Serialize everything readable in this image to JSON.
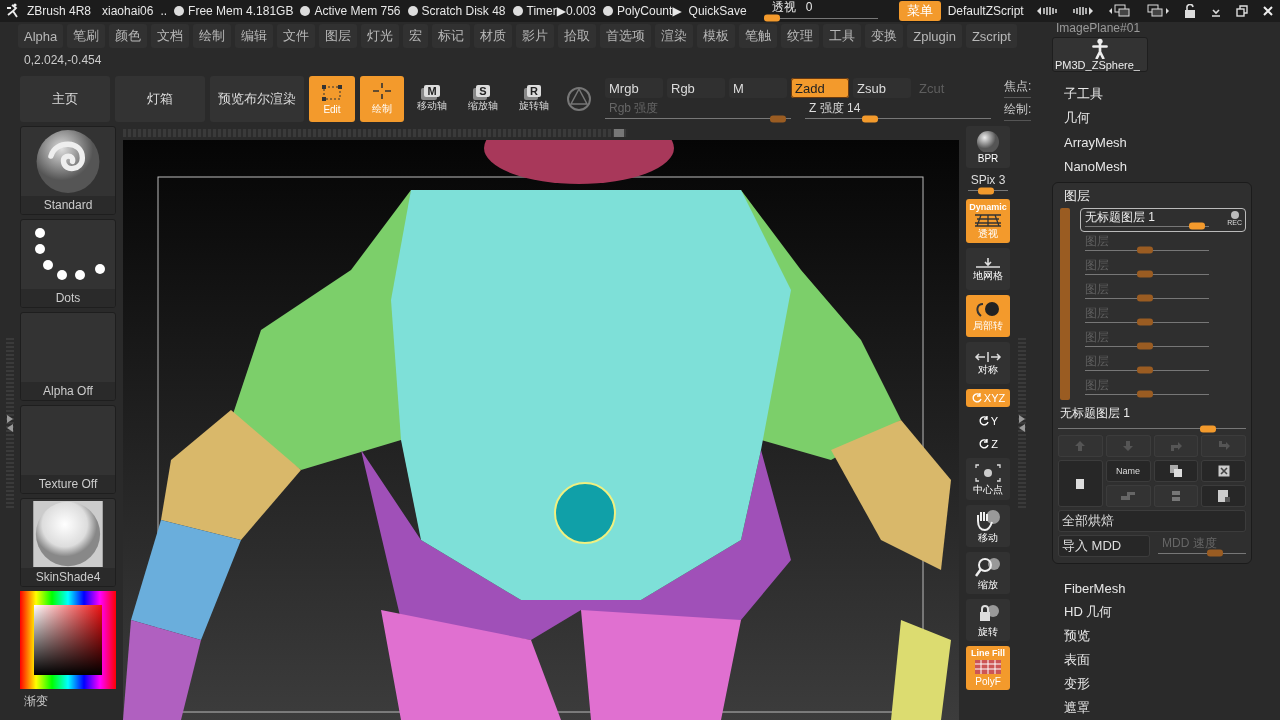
{
  "title_bar": {
    "app": "ZBrush 4R8",
    "user": "xiaohai06",
    "ellipsis": "..",
    "stats": [
      "Free Mem 4.181GB",
      "Active Mem 756",
      "Scratch Disk 48",
      "Timer▶0.003",
      "PolyCount▶"
    ],
    "quick_save": "QuickSave",
    "perspective": {
      "label": "透视",
      "value": "0",
      "level": 0.06
    },
    "menu_button": "菜单",
    "script": "DefaultZScript"
  },
  "menu": [
    "Alpha",
    "笔刷",
    "颜色",
    "文档",
    "绘制",
    "编辑",
    "文件",
    "图层",
    "灯光",
    "宏",
    "标记",
    "材质",
    "影片",
    "拾取",
    "首选项",
    "渲染",
    "模板",
    "笔触",
    "纹理",
    "工具",
    "变换",
    "Zplugin",
    "Zscript"
  ],
  "coordinates": "0,2.024,-0.454",
  "toolbar": [
    {
      "kind": "text",
      "label": "主页"
    },
    {
      "kind": "text",
      "label": "灯箱"
    },
    {
      "kind": "text",
      "label": "预览布尔渲染"
    },
    {
      "kind": "edit",
      "label": "Edit",
      "selected": true
    },
    {
      "kind": "draw",
      "label": "绘制",
      "selected": true
    },
    {
      "kind": "axis",
      "key": "M",
      "label": "移动轴",
      "selected": false
    },
    {
      "kind": "axis",
      "key": "S",
      "label": "缩放轴",
      "selected": false
    },
    {
      "kind": "axis",
      "key": "R",
      "label": "旋转轴",
      "selected": false
    },
    {
      "kind": "sphere"
    }
  ],
  "modes": [
    {
      "label": "Mrgb",
      "selected": false,
      "disabled": false
    },
    {
      "label": "Rgb",
      "selected": false,
      "disabled": false
    },
    {
      "label": "M",
      "selected": false,
      "disabled": false
    },
    {
      "label": "Zadd",
      "selected": true,
      "disabled": false
    },
    {
      "label": "Zsub",
      "selected": false,
      "disabled": false
    },
    {
      "label": "Zcut",
      "selected": false,
      "disabled": true
    }
  ],
  "intensity": [
    {
      "label": "Rgb 强度",
      "level": 0.93,
      "disabled": true
    },
    {
      "label": "Z 强度 14",
      "level": 0.35,
      "disabled": false
    }
  ],
  "side_labels": [
    "焦点:",
    "绘制:"
  ],
  "left_shelf": [
    {
      "kind": "brush",
      "label": "Standard"
    },
    {
      "kind": "stroke",
      "label": "Dots"
    },
    {
      "kind": "empty",
      "label": "Alpha Off"
    },
    {
      "kind": "empty",
      "label": "Texture Off"
    },
    {
      "kind": "material",
      "label": "SkinShade4"
    },
    {
      "kind": "color",
      "label": "渐变"
    }
  ],
  "right_shelf": [
    {
      "kind": "bpr",
      "label": "BPR",
      "selected": false
    },
    {
      "kind": "slider",
      "label": "SPix 3",
      "level": 0.45
    },
    {
      "kind": "persp",
      "top": "Dynamic",
      "label": "透视",
      "selected": true
    },
    {
      "kind": "floor",
      "label": "地网格",
      "selected": false
    },
    {
      "kind": "local",
      "label": "局部转",
      "selected": true
    },
    {
      "kind": "sym",
      "label": "对称",
      "selected": false
    },
    {
      "kind": "xyz",
      "label": "XYZ",
      "selected": true
    },
    {
      "kind": "rot",
      "label": "Y",
      "selected": false
    },
    {
      "kind": "rot",
      "label": "Z",
      "selected": false
    },
    {
      "kind": "center",
      "label": "中心点",
      "selected": false
    },
    {
      "kind": "move",
      "label": "移动",
      "selected": false
    },
    {
      "kind": "zoom",
      "label": "缩放",
      "selected": false
    },
    {
      "kind": "rotate",
      "label": "旋转",
      "selected": false
    },
    {
      "kind": "polyf",
      "top": "Line Fill",
      "label": "PolyF",
      "selected": true
    }
  ],
  "tool_panel": {
    "top_label": "ImagePlane#01",
    "thumbnail": "PM3D_ZSphere_",
    "sections": [
      "子工具",
      "几何",
      "ArrayMesh",
      "NanoMesh"
    ],
    "layers": {
      "title": "图层",
      "items": [
        {
          "name": "无标题图层 1",
          "selected": true,
          "disabled": false,
          "rec": "REC",
          "level": 0.9
        },
        {
          "name": "图层",
          "selected": false,
          "disabled": true,
          "level": 0.48
        },
        {
          "name": "图层",
          "selected": false,
          "disabled": true,
          "level": 0.48
        },
        {
          "name": "图层",
          "selected": false,
          "disabled": true,
          "level": 0.48
        },
        {
          "name": "图层",
          "selected": false,
          "disabled": true,
          "level": 0.48
        },
        {
          "name": "图层",
          "selected": false,
          "disabled": true,
          "level": 0.48
        },
        {
          "name": "图层",
          "selected": false,
          "disabled": true,
          "level": 0.48
        },
        {
          "name": "图层",
          "selected": false,
          "disabled": true,
          "level": 0.48
        }
      ],
      "current": {
        "name": "无标题图层 1",
        "level": 0.8
      },
      "name_button": "Name",
      "bake": "全部烘焙",
      "import": "导入 MDD",
      "mdd_speed": {
        "label": "MDD 速度",
        "level": 0.65,
        "disabled": true
      }
    },
    "sections_after": [
      "FiberMesh",
      "HD 几何",
      "预览",
      "表面",
      "变形",
      "遮罩"
    ]
  }
}
